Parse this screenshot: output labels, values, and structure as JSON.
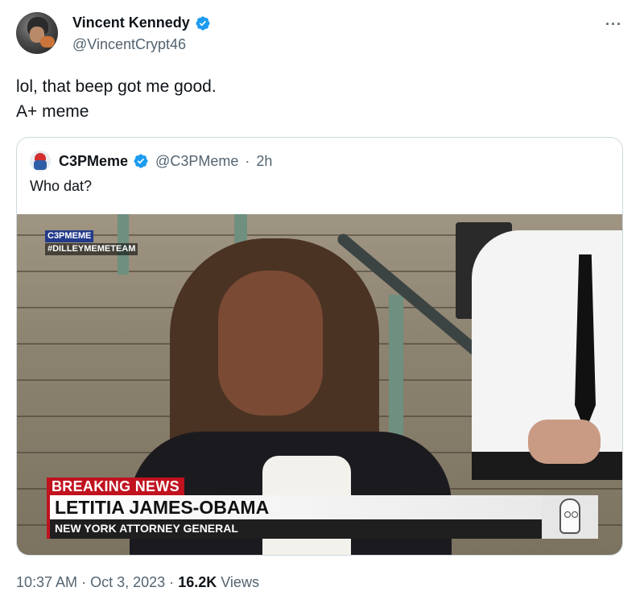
{
  "author": {
    "display_name": "Vincent Kennedy",
    "handle": "@VincentCrypt46",
    "more_label": "···"
  },
  "tweet": {
    "lines": [
      "lol, that beep got me good.",
      "A+ meme"
    ]
  },
  "quote": {
    "display_name": "C3PMeme",
    "handle": "@C3PMeme",
    "separator": "·",
    "age": "2h",
    "text": "Who dat?",
    "media": {
      "watermark_line1": "C3PMEME",
      "watermark_line2": "#DILLEYMEMETEAM",
      "breaking_label": "BREAKING NEWS",
      "name_bar": "LETITIA JAMES-OBAMA",
      "title_bar": "NEW YORK ATTORNEY GENERAL"
    }
  },
  "meta": {
    "time": "10:37 AM",
    "dot1": "·",
    "date": "Oct 3, 2023",
    "dot2": "·",
    "views_count": "16.2K",
    "views_label": "Views"
  },
  "colors": {
    "verified": "#1d9bf0",
    "breaking_red": "#c1121f",
    "muted_text": "#536471"
  }
}
